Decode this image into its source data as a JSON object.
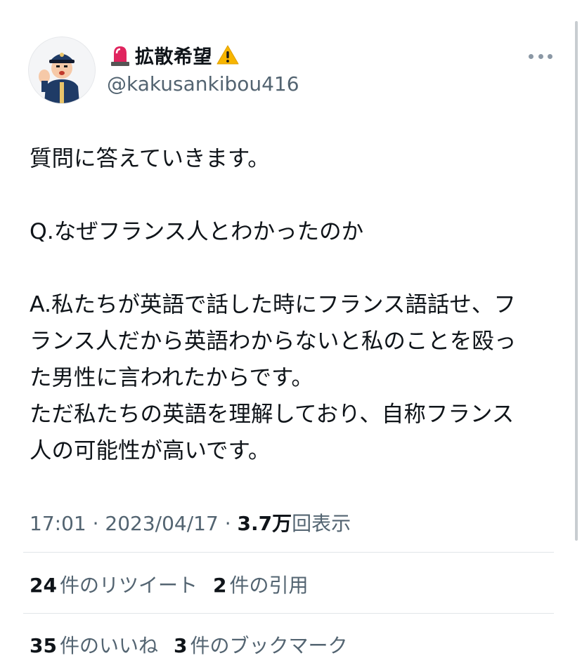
{
  "author": {
    "display_name": "拡散希望",
    "handle": "@kakusankibou416",
    "name_prefix_icon": "rotating-light-icon",
    "name_suffix_icon": "warning-icon",
    "avatar": "police-officer-avatar"
  },
  "tweet": {
    "lines": [
      "質問に答えていきます。",
      "",
      "Q.なぜフランス人とわかったのか",
      "",
      "A.私たちが英語で話した時にフランス語話せ、フ",
      "ランス人だから英語わからないと私のことを殴っ",
      "た男性に言われたからです。",
      "ただ私たちの英語を理解しており、自称フランス",
      "人の可能性が高いです。"
    ],
    "time": "17:01",
    "date": "2023/04/17",
    "separator": "·",
    "views_count": "3.7万",
    "views_label": "回表示"
  },
  "stats": {
    "retweets_count": "24",
    "retweets_label": "件のリツイート",
    "quotes_count": "2",
    "quotes_label": "件の引用",
    "likes_count": "35",
    "likes_label": "件のいいね",
    "bookmarks_count": "3",
    "bookmarks_label": "件のブックマーク"
  },
  "colors": {
    "text": "#0f1419",
    "secondary": "#536471",
    "divider": "#e1e5e8"
  }
}
